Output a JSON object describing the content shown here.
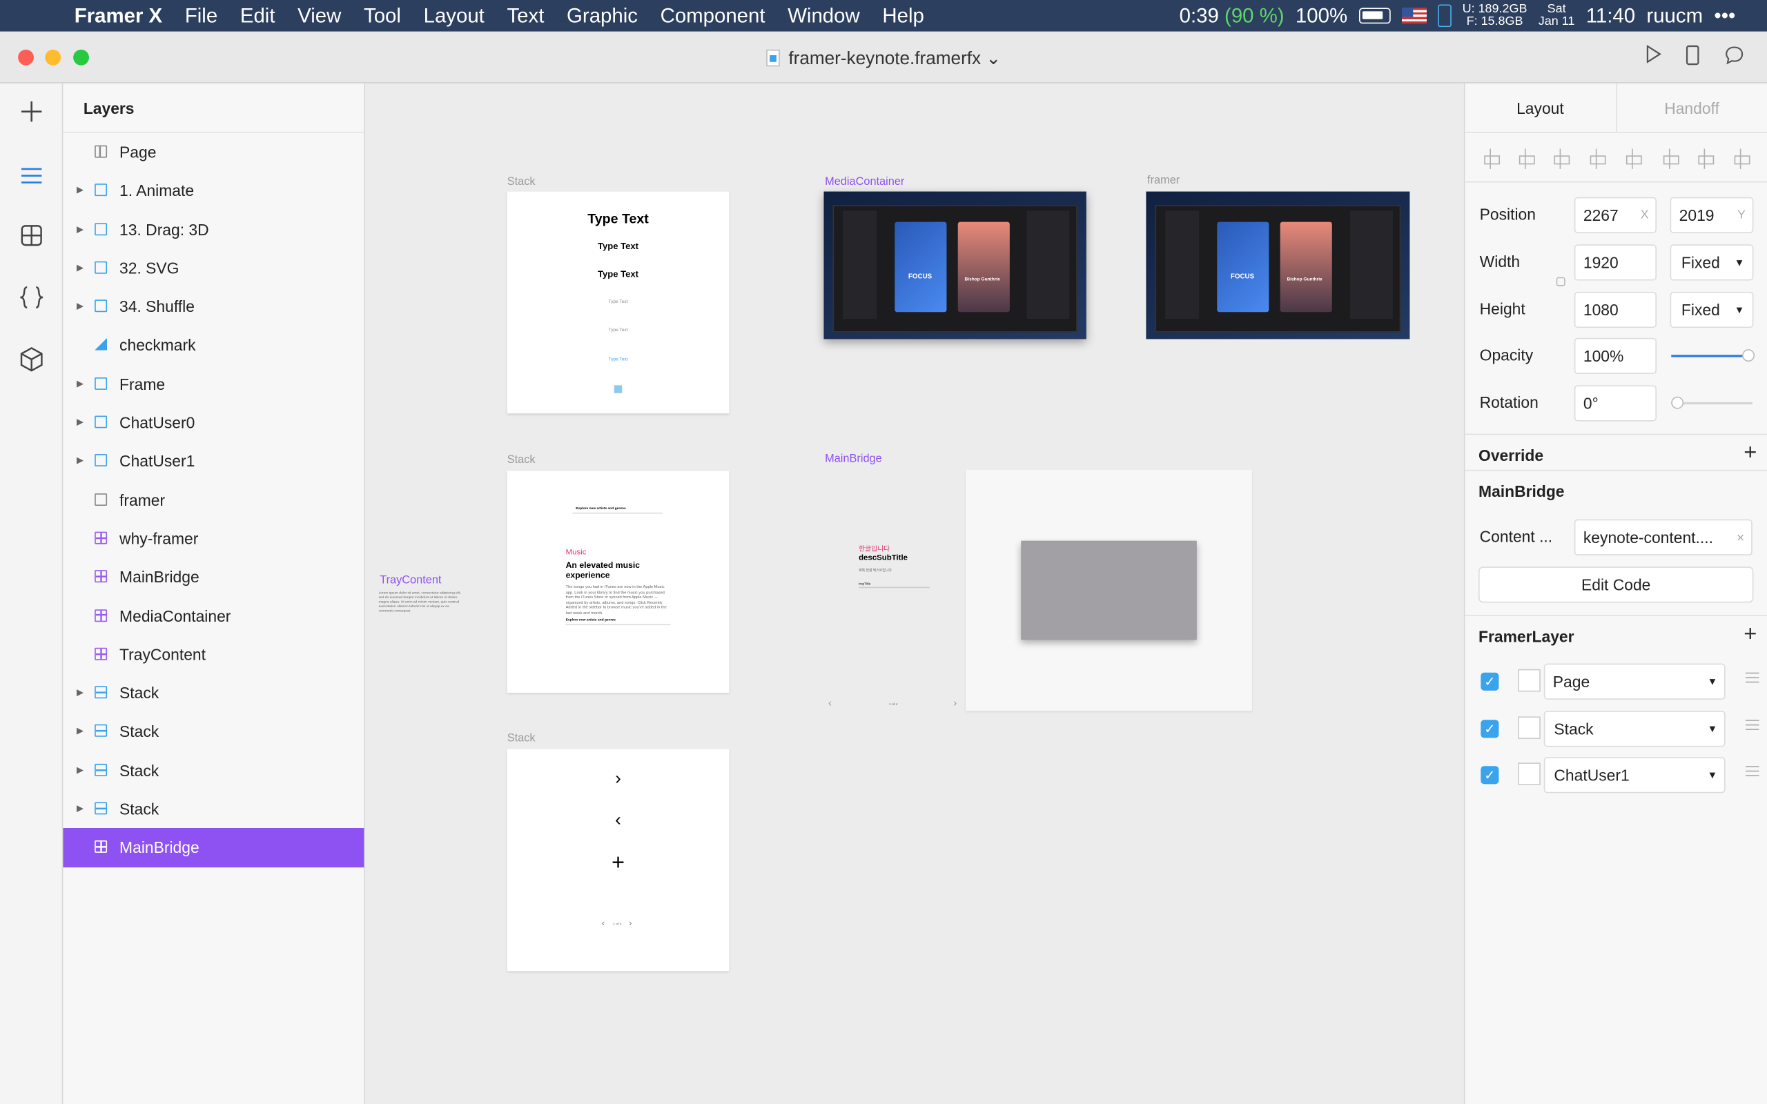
{
  "menubar": {
    "app_name": "Framer X",
    "menus": [
      "File",
      "Edit",
      "View",
      "Tool",
      "Layout",
      "Text",
      "Graphic",
      "Component",
      "Window",
      "Help"
    ],
    "battery_time": "0:39",
    "battery_pct": "(90 %)",
    "volume": "100%",
    "disk_u": "U: 189.2GB",
    "disk_f": "F:   15.8GB",
    "day": "Sat",
    "date": "Jan 11",
    "time": "11:40",
    "user": "ruucm",
    "more": "•••"
  },
  "titlebar": {
    "doc_title": "framer-keynote.framerfx",
    "title_chevron": "⌄"
  },
  "layers": {
    "header": "Layers",
    "items": [
      {
        "label": "Page",
        "icon": "page-icon",
        "expand": false
      },
      {
        "label": "1. Animate",
        "icon": "frame-icon",
        "expand": true
      },
      {
        "label": "13. Drag: 3D",
        "icon": "frame-icon",
        "expand": true
      },
      {
        "label": "32. SVG",
        "icon": "frame-icon",
        "expand": true
      },
      {
        "label": "34. Shuffle",
        "icon": "frame-icon",
        "expand": true
      },
      {
        "label": "checkmark",
        "icon": "path-icon",
        "expand": false
      },
      {
        "label": "Frame",
        "icon": "frame-icon",
        "expand": true
      },
      {
        "label": "ChatUser0",
        "icon": "frame-icon",
        "expand": true
      },
      {
        "label": "ChatUser1",
        "icon": "frame-icon",
        "expand": true
      },
      {
        "label": "framer",
        "icon": "empty-frame-icon",
        "expand": false
      },
      {
        "label": "why-framer",
        "icon": "component-icon",
        "expand": false
      },
      {
        "label": "MainBridge",
        "icon": "component-icon",
        "expand": false
      },
      {
        "label": "MediaContainer",
        "icon": "component-icon",
        "expand": false
      },
      {
        "label": "TrayContent",
        "icon": "component-icon",
        "expand": false
      },
      {
        "label": "Stack",
        "icon": "stack-icon",
        "expand": true
      },
      {
        "label": "Stack",
        "icon": "stack-icon",
        "expand": true
      },
      {
        "label": "Stack",
        "icon": "stack-icon",
        "expand": true
      },
      {
        "label": "Stack",
        "icon": "stack-icon",
        "expand": true
      },
      {
        "label": "MainBridge",
        "icon": "component-icon",
        "expand": false,
        "selected": true
      }
    ]
  },
  "canvas": {
    "labels": {
      "stack1": "Stack",
      "media": "MediaContainer",
      "framer": "framer",
      "stack2": "Stack",
      "mainbridge": "MainBridge",
      "tray": "TrayContent",
      "stack3": "Stack"
    },
    "stack1_texts": [
      "Type Text",
      "Type Text",
      "Type Text",
      "Type Text",
      "Type Text",
      "Type Text"
    ],
    "shot_texts": {
      "focus": "FOCUS",
      "card2": "Bishop Gunthrie"
    },
    "stack2": {
      "search": "Explore new artists and genres",
      "tag": "Music",
      "heading": "An elevated music experience",
      "body": "The songs you had in iTunes are now in the Apple Music app. Look in your library to find the music you purchased from the iTunes Store or synced from Apple Music — organized by artists, albums, and songs. Click Recently Added in the sidebar to browse music you've added in the last week and month.",
      "footer": "Explore new artists and genres"
    },
    "tray_body": "Lorem ipsum dolor sit amet, consectetur adipiscing elit, sed do eiusmod tempor incididunt ut labore et dolore magna aliqua. Ut enim ad minim veniam, quis nostrud exercitation ullamco laboris nisi ut aliquip ex ea commodo consequat.",
    "mainbridge": {
      "korean": "한글입니다",
      "subtitle": "descSubTitle",
      "small": "제목 한글 텍스트입니다",
      "row": "trayTitle",
      "page": "1 of 4"
    },
    "stack3": {
      "next": "›",
      "prev": "‹",
      "plus": "+",
      "page": "1 of 4"
    }
  },
  "panel": {
    "tabs": [
      "Layout",
      "Handoff"
    ],
    "position_label": "Position",
    "x": "2267",
    "x_suffix": "X",
    "y": "2019",
    "y_suffix": "Y",
    "width_label": "Width",
    "width": "1920",
    "width_mode": "Fixed",
    "height_label": "Height",
    "height": "1080",
    "height_mode": "Fixed",
    "opacity_label": "Opacity",
    "opacity": "100%",
    "opacity_value": 1.0,
    "rotation_label": "Rotation",
    "rotation": "0°",
    "rotation_value": 0,
    "override_label": "Override",
    "override_component": "MainBridge",
    "content_label": "Content ...",
    "content_value": "keynote-content....",
    "content_clear": "×",
    "edit_code": "Edit Code",
    "framer_layer_label": "FramerLayer",
    "framer_layers": [
      {
        "name": "Page",
        "checked": true
      },
      {
        "name": "Stack",
        "checked": true
      },
      {
        "name": "ChatUser1",
        "checked": true
      }
    ]
  },
  "colors": {
    "accent": "#2a7de1",
    "selection": "#8f52f2",
    "menubar": "#2d3f5e",
    "battery_green": "#5ed66b"
  }
}
